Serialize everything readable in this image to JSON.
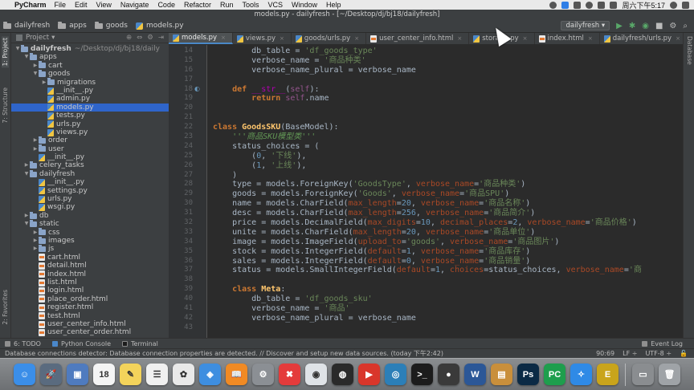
{
  "menubar": {
    "app_name": "PyCharm",
    "items": [
      "File",
      "Edit",
      "View",
      "Navigate",
      "Code",
      "Refactor",
      "Run",
      "Tools",
      "VCS",
      "Window",
      "Help"
    ],
    "clock": "周六下午5:17"
  },
  "window_title": "models.py - dailyfresh - [~/Desktop/dj/bj18/dailyfresh]",
  "breadcrumbs": [
    "dailyfresh",
    "apps",
    "goods",
    "models.py"
  ],
  "run_config": "dailyfresh",
  "project_panel": {
    "title": "Project",
    "tree": [
      {
        "label": "dailyfresh",
        "suffix": "~/Desktop/dj/bj18/daily",
        "type": "folder",
        "depth": 0,
        "expanded": true
      },
      {
        "label": "apps",
        "type": "folder",
        "depth": 1,
        "expanded": true
      },
      {
        "label": "cart",
        "type": "folder",
        "depth": 2,
        "expanded": false
      },
      {
        "label": "goods",
        "type": "folder",
        "depth": 2,
        "expanded": true
      },
      {
        "label": "migrations",
        "type": "folder",
        "depth": 3,
        "expanded": false
      },
      {
        "label": "__init__.py",
        "type": "py",
        "depth": 3
      },
      {
        "label": "admin.py",
        "type": "py",
        "depth": 3
      },
      {
        "label": "models.py",
        "type": "py",
        "depth": 3,
        "selected": true
      },
      {
        "label": "tests.py",
        "type": "py",
        "depth": 3
      },
      {
        "label": "urls.py",
        "type": "py",
        "depth": 3
      },
      {
        "label": "views.py",
        "type": "py",
        "depth": 3
      },
      {
        "label": "order",
        "type": "folder",
        "depth": 2,
        "expanded": false
      },
      {
        "label": "user",
        "type": "folder",
        "depth": 2,
        "expanded": false
      },
      {
        "label": "__init__.py",
        "type": "py",
        "depth": 2
      },
      {
        "label": "celery_tasks",
        "type": "folder",
        "depth": 1,
        "expanded": false
      },
      {
        "label": "dailyfresh",
        "type": "folder",
        "depth": 1,
        "expanded": true
      },
      {
        "label": "__init__.py",
        "type": "py",
        "depth": 2
      },
      {
        "label": "settings.py",
        "type": "py",
        "depth": 2
      },
      {
        "label": "urls.py",
        "type": "py",
        "depth": 2
      },
      {
        "label": "wsgi.py",
        "type": "py",
        "depth": 2
      },
      {
        "label": "db",
        "type": "folder",
        "depth": 1,
        "expanded": false
      },
      {
        "label": "static",
        "type": "folder",
        "depth": 1,
        "expanded": true
      },
      {
        "label": "css",
        "type": "folder",
        "depth": 2,
        "expanded": false
      },
      {
        "label": "images",
        "type": "folder",
        "depth": 2,
        "expanded": false
      },
      {
        "label": "js",
        "type": "folder",
        "depth": 2,
        "expanded": false
      },
      {
        "label": "cart.html",
        "type": "html",
        "depth": 2
      },
      {
        "label": "detail.html",
        "type": "html",
        "depth": 2
      },
      {
        "label": "index.html",
        "type": "html",
        "depth": 2
      },
      {
        "label": "list.html",
        "type": "html",
        "depth": 2
      },
      {
        "label": "login.html",
        "type": "html",
        "depth": 2
      },
      {
        "label": "place_order.html",
        "type": "html",
        "depth": 2
      },
      {
        "label": "register.html",
        "type": "html",
        "depth": 2
      },
      {
        "label": "test.html",
        "type": "html",
        "depth": 2
      },
      {
        "label": "user_center_info.html",
        "type": "html",
        "depth": 2
      },
      {
        "label": "user_center_order.html",
        "type": "html",
        "depth": 2
      }
    ]
  },
  "left_strip_tabs": [
    "1: Project",
    "7: Structure",
    "2: Favorites"
  ],
  "right_strip_tabs": [
    "Database"
  ],
  "editor_tabs": [
    {
      "label": "models.py",
      "type": "py",
      "active": true
    },
    {
      "label": "views.py",
      "type": "py"
    },
    {
      "label": "goods/urls.py",
      "type": "py"
    },
    {
      "label": "user_center_info.html",
      "type": "html"
    },
    {
      "label": "storage.py",
      "type": "py"
    },
    {
      "label": "index.html",
      "type": "html"
    },
    {
      "label": "dailyfresh/urls.py",
      "type": "py"
    }
  ],
  "editor": {
    "line_numbers": [
      "14",
      "15",
      "16",
      "17",
      "18",
      "19",
      "20",
      "21",
      "22",
      "23",
      "24",
      "25",
      "26",
      "27",
      "28",
      "29",
      "30",
      "31",
      "32",
      "33",
      "34",
      "35",
      "36",
      "37",
      "38",
      "39",
      "40",
      "41",
      "42",
      "43"
    ],
    "lines": [
      [
        {
          "t": "        db_table = ",
          "c": "n"
        },
        {
          "t": "'df_goods_type'",
          "c": "s"
        }
      ],
      [
        {
          "t": "        verbose_name = ",
          "c": "n"
        },
        {
          "t": "'商品种类'",
          "c": "s"
        }
      ],
      [
        {
          "t": "        verbose_name_plural = verbose_name",
          "c": "n"
        }
      ],
      [
        {
          "t": "",
          "c": "n"
        }
      ],
      [
        {
          "t": "    ",
          "c": "n"
        },
        {
          "t": "def ",
          "c": "k"
        },
        {
          "t": "__str__",
          "c": "m"
        },
        {
          "t": "(",
          "c": "n"
        },
        {
          "t": "self",
          "c": "self"
        },
        {
          "t": "):",
          "c": "n"
        }
      ],
      [
        {
          "t": "        ",
          "c": "n"
        },
        {
          "t": "return ",
          "c": "k"
        },
        {
          "t": "self",
          "c": "self"
        },
        {
          "t": ".name",
          "c": "n"
        }
      ],
      [
        {
          "t": "",
          "c": "n"
        }
      ],
      [
        {
          "t": "",
          "c": "n"
        }
      ],
      [
        {
          "t": "class ",
          "c": "k"
        },
        {
          "t": "GoodsSKU",
          "c": "cls"
        },
        {
          "t": "(BaseModel):",
          "c": "n"
        }
      ],
      [
        {
          "t": "    ",
          "c": "n"
        },
        {
          "t": "'''商品SKU模型类'''",
          "c": "doc"
        }
      ],
      [
        {
          "t": "    status_choices = (",
          "c": "n"
        }
      ],
      [
        {
          "t": "        (",
          "c": "n"
        },
        {
          "t": "0",
          "c": "num"
        },
        {
          "t": ", ",
          "c": "n"
        },
        {
          "t": "'下线'",
          "c": "s"
        },
        {
          "t": "),",
          "c": "n"
        }
      ],
      [
        {
          "t": "        (",
          "c": "n"
        },
        {
          "t": "1",
          "c": "num"
        },
        {
          "t": ", ",
          "c": "n"
        },
        {
          "t": "'上线'",
          "c": "s"
        },
        {
          "t": "),",
          "c": "n"
        }
      ],
      [
        {
          "t": "    )",
          "c": "n"
        }
      ],
      [
        {
          "t": "    type = models.ForeignKey(",
          "c": "n"
        },
        {
          "t": "'GoodsType'",
          "c": "s"
        },
        {
          "t": ", ",
          "c": "n"
        },
        {
          "t": "verbose_name",
          "c": "kw"
        },
        {
          "t": "=",
          "c": "n"
        },
        {
          "t": "'商品种类'",
          "c": "s"
        },
        {
          "t": ")",
          "c": "n"
        }
      ],
      [
        {
          "t": "    goods = models.ForeignKey(",
          "c": "n"
        },
        {
          "t": "'Goods'",
          "c": "s"
        },
        {
          "t": ", ",
          "c": "n"
        },
        {
          "t": "verbose_name",
          "c": "kw"
        },
        {
          "t": "=",
          "c": "n"
        },
        {
          "t": "'商品SPU'",
          "c": "s"
        },
        {
          "t": ")",
          "c": "n"
        }
      ],
      [
        {
          "t": "    name = models.CharField(",
          "c": "n"
        },
        {
          "t": "max_length",
          "c": "kw"
        },
        {
          "t": "=",
          "c": "n"
        },
        {
          "t": "20",
          "c": "num"
        },
        {
          "t": ", ",
          "c": "n"
        },
        {
          "t": "verbose_name",
          "c": "kw"
        },
        {
          "t": "=",
          "c": "n"
        },
        {
          "t": "'商品名称'",
          "c": "s"
        },
        {
          "t": ")",
          "c": "n"
        }
      ],
      [
        {
          "t": "    desc = models.CharField(",
          "c": "n"
        },
        {
          "t": "max_length",
          "c": "kw"
        },
        {
          "t": "=",
          "c": "n"
        },
        {
          "t": "256",
          "c": "num"
        },
        {
          "t": ", ",
          "c": "n"
        },
        {
          "t": "verbose_name",
          "c": "kw"
        },
        {
          "t": "=",
          "c": "n"
        },
        {
          "t": "'商品简介'",
          "c": "s"
        },
        {
          "t": ")",
          "c": "n"
        }
      ],
      [
        {
          "t": "    price = models.DecimalField(",
          "c": "n"
        },
        {
          "t": "max_digits",
          "c": "kw"
        },
        {
          "t": "=",
          "c": "n"
        },
        {
          "t": "10",
          "c": "num"
        },
        {
          "t": ", ",
          "c": "n"
        },
        {
          "t": "decimal_places",
          "c": "kw"
        },
        {
          "t": "=",
          "c": "n"
        },
        {
          "t": "2",
          "c": "num"
        },
        {
          "t": ", ",
          "c": "n"
        },
        {
          "t": "verbose_name",
          "c": "kw"
        },
        {
          "t": "=",
          "c": "n"
        },
        {
          "t": "'商品价格'",
          "c": "s"
        },
        {
          "t": ")",
          "c": "n"
        }
      ],
      [
        {
          "t": "    unite = models.CharField(",
          "c": "n"
        },
        {
          "t": "max_length",
          "c": "kw"
        },
        {
          "t": "=",
          "c": "n"
        },
        {
          "t": "20",
          "c": "num"
        },
        {
          "t": ", ",
          "c": "n"
        },
        {
          "t": "verbose_name",
          "c": "kw"
        },
        {
          "t": "=",
          "c": "n"
        },
        {
          "t": "'商品单位'",
          "c": "s"
        },
        {
          "t": ")",
          "c": "n"
        }
      ],
      [
        {
          "t": "    image = models.ImageField(",
          "c": "n"
        },
        {
          "t": "upload_to",
          "c": "kw"
        },
        {
          "t": "=",
          "c": "n"
        },
        {
          "t": "'goods'",
          "c": "s"
        },
        {
          "t": ", ",
          "c": "n"
        },
        {
          "t": "verbose_name",
          "c": "kw"
        },
        {
          "t": "=",
          "c": "n"
        },
        {
          "t": "'商品图片'",
          "c": "s"
        },
        {
          "t": ")",
          "c": "n"
        }
      ],
      [
        {
          "t": "    stock = models.IntegerField(",
          "c": "n"
        },
        {
          "t": "default",
          "c": "kw"
        },
        {
          "t": "=",
          "c": "n"
        },
        {
          "t": "1",
          "c": "num"
        },
        {
          "t": ", ",
          "c": "n"
        },
        {
          "t": "verbose_name",
          "c": "kw"
        },
        {
          "t": "=",
          "c": "n"
        },
        {
          "t": "'商品库存'",
          "c": "s"
        },
        {
          "t": ")",
          "c": "n"
        }
      ],
      [
        {
          "t": "    sales = models.IntegerField(",
          "c": "n"
        },
        {
          "t": "default",
          "c": "kw"
        },
        {
          "t": "=",
          "c": "n"
        },
        {
          "t": "0",
          "c": "num"
        },
        {
          "t": ", ",
          "c": "n"
        },
        {
          "t": "verbose_name",
          "c": "kw"
        },
        {
          "t": "=",
          "c": "n"
        },
        {
          "t": "'商品销量'",
          "c": "s"
        },
        {
          "t": ")",
          "c": "n"
        }
      ],
      [
        {
          "t": "    status = models.SmallIntegerField(",
          "c": "n"
        },
        {
          "t": "default",
          "c": "kw"
        },
        {
          "t": "=",
          "c": "n"
        },
        {
          "t": "1",
          "c": "num"
        },
        {
          "t": ", ",
          "c": "n"
        },
        {
          "t": "choices",
          "c": "kw"
        },
        {
          "t": "=status_choices, ",
          "c": "n"
        },
        {
          "t": "verbose_name",
          "c": "kw"
        },
        {
          "t": "=",
          "c": "n"
        },
        {
          "t": "'商",
          "c": "s"
        }
      ],
      [
        {
          "t": "",
          "c": "n"
        }
      ],
      [
        {
          "t": "    ",
          "c": "n"
        },
        {
          "t": "class ",
          "c": "k"
        },
        {
          "t": "Meta",
          "c": "cls"
        },
        {
          "t": ":",
          "c": "n"
        }
      ],
      [
        {
          "t": "        db_table = ",
          "c": "n"
        },
        {
          "t": "'df_goods_sku'",
          "c": "s"
        }
      ],
      [
        {
          "t": "        verbose_name = ",
          "c": "n"
        },
        {
          "t": "'商品'",
          "c": "s"
        }
      ],
      [
        {
          "t": "        verbose_name_plural = verbose_name",
          "c": "n"
        }
      ],
      [
        {
          "t": "",
          "c": "n"
        }
      ]
    ]
  },
  "bottom_tools": {
    "todo": "6: TODO",
    "console": "Python Console",
    "terminal": "Terminal",
    "event_log": "Event Log"
  },
  "statusbar": {
    "message": "Database connections detector: Database connection properties are detected. // Discover and setup new data sources. (today 下午2:42)",
    "position": "90:69",
    "line_sep": "LF ÷",
    "encoding": "UTF-8 ÷"
  },
  "dock_apps": [
    {
      "name": "finder",
      "glyph": "☺",
      "color": "#3b8ee8"
    },
    {
      "name": "launchpad",
      "glyph": "🚀",
      "color": "#5a6b7f"
    },
    {
      "name": "preview",
      "glyph": "▣",
      "color": "#4f7bbf"
    },
    {
      "name": "calendar",
      "glyph": "18",
      "color": "#f4f4f4"
    },
    {
      "name": "notes",
      "glyph": "✎",
      "color": "#f3d35b"
    },
    {
      "name": "reminders",
      "glyph": "☰",
      "color": "#f0f0f0"
    },
    {
      "name": "photos",
      "glyph": "✿",
      "color": "#e9e9e9"
    },
    {
      "name": "keynote",
      "glyph": "◈",
      "color": "#3e8ee0"
    },
    {
      "name": "ibooks",
      "glyph": "📖",
      "color": "#f08a24"
    },
    {
      "name": "system-preferences",
      "glyph": "⚙",
      "color": "#8b8f94"
    },
    {
      "name": "xmind",
      "glyph": "✖",
      "color": "#e43b3b"
    },
    {
      "name": "chrome",
      "glyph": "◉",
      "color": "#dfe3e7"
    },
    {
      "name": "qq",
      "glyph": "◍",
      "color": "#2a2a2a"
    },
    {
      "name": "screen-recorder",
      "glyph": "▶",
      "color": "#d9362b"
    },
    {
      "name": "sourcetree",
      "glyph": "◎",
      "color": "#2c7fb8"
    },
    {
      "name": "terminal",
      "glyph": ">_",
      "color": "#1c1c1c"
    },
    {
      "name": "obs",
      "glyph": "●",
      "color": "#3a3a3a"
    },
    {
      "name": "word",
      "glyph": "W",
      "color": "#2b5797"
    },
    {
      "name": "archive",
      "glyph": "▤",
      "color": "#c98f3b"
    },
    {
      "name": "photoshop",
      "glyph": "Ps",
      "color": "#0b2a45"
    },
    {
      "name": "pycharm",
      "glyph": "PC",
      "color": "#1e9e4d"
    },
    {
      "name": "safari",
      "glyph": "✧",
      "color": "#2f8ae6"
    },
    {
      "name": "editor",
      "glyph": "E",
      "color": "#c9a41b"
    },
    {
      "name": "downloads",
      "glyph": "▭",
      "color": "#8a8d90"
    },
    {
      "name": "trash",
      "glyph": "🗑",
      "color": "#9fa3a7"
    }
  ],
  "colors": {
    "keyword": "#cc7832",
    "string": "#6a8759",
    "number": "#6897bb",
    "keyword_arg": "#aa4926",
    "self": "#94558d",
    "magic": "#b200b2",
    "docstring": "#629755",
    "default": "#a9b7c6",
    "class_name": "#ffc66d",
    "accent": "#4a88c7"
  }
}
